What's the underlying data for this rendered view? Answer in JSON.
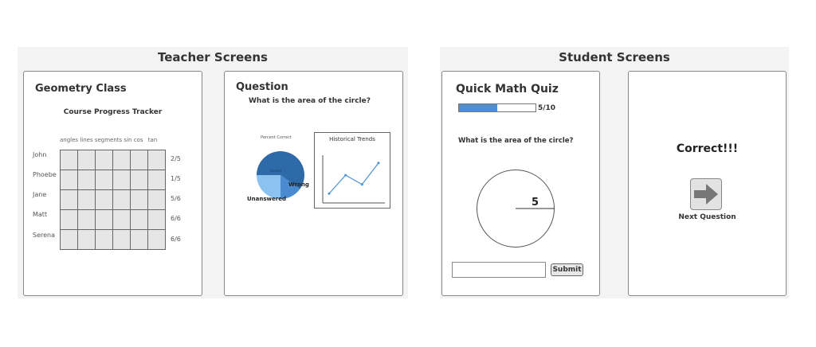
{
  "teacher": {
    "section_title": "Teacher Screens",
    "class_card": {
      "title": "Geometry Class",
      "subtitle": "Course Progress Tracker",
      "columns": [
        "angles",
        "lines",
        "segments",
        "sin",
        "cos",
        "tan"
      ],
      "rows": [
        {
          "name": "John",
          "score": "2/5"
        },
        {
          "name": "Phoebe",
          "score": "1/5"
        },
        {
          "name": "Jane",
          "score": "5/6"
        },
        {
          "name": "Matt",
          "score": "6/6"
        },
        {
          "name": "Serena",
          "score": "6/6"
        }
      ]
    },
    "question_card": {
      "title": "Question",
      "question": "What is the area of the circle?",
      "pie_title": "Percent Correct",
      "pie_labels": {
        "correct": "Correct",
        "wrong": "Wrong",
        "unanswered": "Unanswered"
      },
      "trends_title": "Historical Trends"
    }
  },
  "student": {
    "section_title": "Student Screens",
    "quiz_card": {
      "title": "Quick Math Quiz",
      "progress_text": "5/10",
      "progress_fraction": 0.5,
      "question": "What is the area of the circle?",
      "radius_label": "5",
      "submit_label": "Submit",
      "answer_value": ""
    },
    "result_card": {
      "title": "Correct!!!",
      "next_label": "Next Question"
    }
  },
  "colors": {
    "pie_correct": "#2f6aa8",
    "pie_wrong": "#4a8bd0",
    "pie_unanswered": "#8cc2f0",
    "progress_fill": "#4a90d2",
    "line": "#4a90d2"
  },
  "chart_data": [
    {
      "type": "pie",
      "title": "Percent Correct",
      "labels": [
        "Correct",
        "Wrong",
        "Unanswered"
      ],
      "values": [
        60,
        15,
        25
      ]
    },
    {
      "type": "line",
      "title": "Historical Trends",
      "x": [
        1,
        2,
        3,
        4
      ],
      "y": [
        1,
        4,
        2.5,
        6
      ],
      "ylim": [
        0,
        7
      ]
    }
  ]
}
